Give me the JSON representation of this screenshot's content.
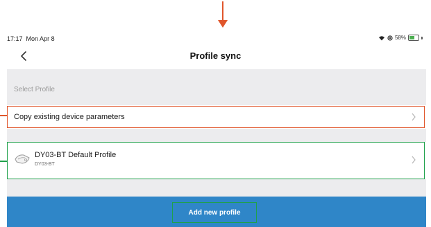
{
  "status_bar": {
    "time": "17:17",
    "date": "Mon Apr 8",
    "battery_percent": "58%",
    "battery_level": 0.58
  },
  "nav": {
    "title": "Profile sync",
    "back_icon": "chevron-left-icon"
  },
  "section": {
    "label": "Select Profile"
  },
  "copy_row": {
    "label": "Copy existing device parameters",
    "chevron_icon": "chevron-right-icon"
  },
  "profile_row": {
    "name": "DY03-BT Default Profile",
    "model": "DY03-BT",
    "icon": "device-icon",
    "chevron_icon": "chevron-right-icon"
  },
  "footer": {
    "add_button_label": "Add new profile"
  },
  "colors": {
    "accent_blue": "#2f86c8",
    "highlight_orange": "#e0562b",
    "highlight_green": "#1fa14a",
    "background_gray": "#ececee"
  }
}
